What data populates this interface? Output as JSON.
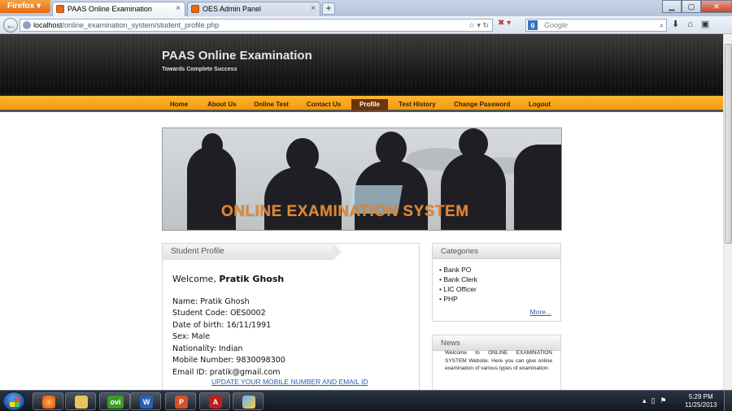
{
  "browser": {
    "app_button": "Firefox",
    "tabs": [
      {
        "title": "PAAS Online Examination",
        "active": true
      },
      {
        "title": "OES Admin Panel",
        "active": false
      }
    ],
    "url_host": "localhost",
    "url_path": "/online_examination_system/student_profile.php",
    "search_engine_label": "g",
    "search_placeholder": "Google"
  },
  "site": {
    "title": "PAAS Online Examination",
    "tagline": "Towards Complete Success"
  },
  "menu": {
    "items": [
      {
        "label": "Home"
      },
      {
        "label": "About Us"
      },
      {
        "label": "Online Test"
      },
      {
        "label": "Contact Us"
      },
      {
        "label": "Profile",
        "active": true
      },
      {
        "label": "Test History"
      },
      {
        "label": "Change Password"
      },
      {
        "label": "Logout"
      }
    ]
  },
  "banner": {
    "text": "ONLINE EXAMINATION SYSTEM"
  },
  "profile": {
    "box_title": "Student Profile",
    "welcome_prefix": "Welcome,",
    "student_name": "Pratik Ghosh",
    "details": [
      "Name: Pratik Ghosh",
      "Student Code: OES0002",
      "Date of birth: 16/11/1991",
      "Sex: Male",
      "Nationality: Indian",
      "Mobile Number: 9830098300",
      "Email ID: pratik@gmail.com"
    ],
    "update_link": "UPDATE YOUR MOBILE NUMBER AND EMAIL ID"
  },
  "categories": {
    "title": "Categories",
    "items": [
      "Bank PO",
      "Bank Clerk",
      "LIC Officer",
      "PHP"
    ],
    "more": "More..."
  },
  "news": {
    "title": "News",
    "text": "Welcome to ONLINE EXAMINATION SYSTEM Website. Here you can give online examination of various types of examination."
  },
  "taskbar": {
    "time": "5:29 PM",
    "date": "11/25/2013",
    "apps": [
      "firefox",
      "explorer",
      "ovi",
      "word",
      "powerpoint",
      "acrobat",
      "paint"
    ]
  },
  "colors": {
    "menu_orange": "#f59a0c",
    "menu_active": "#6b3608",
    "header_dark": "#1a1a1a",
    "link_blue": "#2a5db0",
    "banner_text": "#d98a3a"
  }
}
